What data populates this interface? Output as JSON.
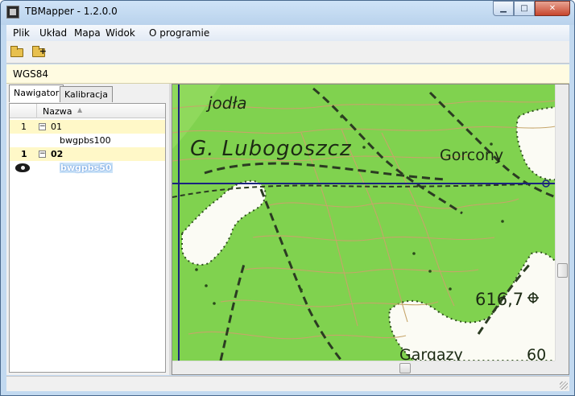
{
  "window": {
    "title": "TBMapper - 1.2.0.0",
    "controls": {
      "minimize": "▁",
      "maximize": "□",
      "close": "✕"
    }
  },
  "menu": [
    "Plik",
    "Układ",
    "Mapa",
    "Widok",
    "O programie"
  ],
  "toolbar": {
    "buttons": [
      "open-folder-icon",
      "add-folder-icon"
    ]
  },
  "crs": {
    "label": "WGS84"
  },
  "panel": {
    "tabs": [
      "Nawigator",
      "Kalibracja"
    ],
    "active_tab": "Nawigator",
    "tree": {
      "column": "Nazwa",
      "groups": [
        {
          "number": "1",
          "name": "01",
          "expanded": true,
          "children": [
            {
              "name": "bwgpbs100",
              "visible": false,
              "selected": false
            }
          ]
        },
        {
          "number": "1",
          "name": "02",
          "expanded": true,
          "bold": true,
          "children": [
            {
              "name": "bwgpbs50",
              "visible": true,
              "selected": true
            }
          ]
        }
      ]
    }
  },
  "map": {
    "labels": {
      "peak_jodla": "jodła",
      "mountain": "G. Lubogoszcz",
      "place_gorcony": "Gorcony",
      "elevation": "616,7",
      "place_gargazy": "Gargazy",
      "elevation_partial": "60"
    },
    "colors": {
      "forest": "#7fd250",
      "clearing": "#fbfbf4",
      "contour": "#c0a060",
      "crosshair": "#1a237e"
    }
  }
}
